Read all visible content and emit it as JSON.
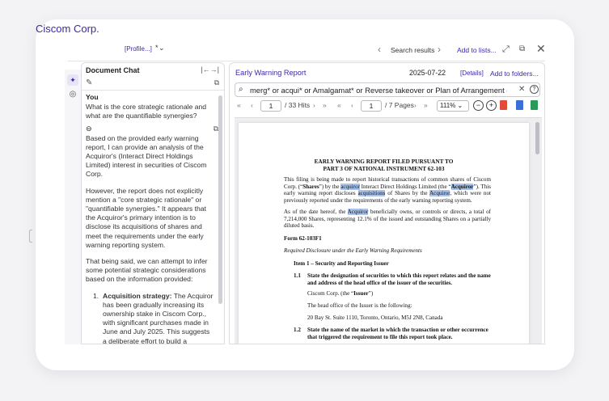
{
  "header": {
    "company": "Ciscom Corp.",
    "profile_link": "[Profile...]",
    "star_mark": "*",
    "nav_label": "Search results",
    "add_to_lists": "Add to lists..."
  },
  "chat": {
    "title": "Document Chat",
    "you_label": "You",
    "question": "What is the core strategic rationale and what are the quantifiable synergies?",
    "paragraphs": [
      "Based on the provided early warning report, I can provide an analysis of the Acquiror's (Interact Direct Holdings Limited) interest in securities of Ciscom Corp.",
      "However, the report does not explicitly mention a \"core strategic rationale\" or \"quantifiable synergies.\" It appears that the Acquiror's primary intention is to disclose its acquisitions of shares and meet the requirements under the early warning reporting system.",
      "That being said, we can attempt to infer some potential strategic considerations based on the information provided:"
    ],
    "list": [
      {
        "num": "1.",
        "title": "Acquisition strategy:",
        "text": " The Acquiror has been gradually increasing its ownership stake in Ciscom Corp., with significant purchases made in June and July 2025. This suggests a deliberate effort to build a substantial shareholding position, which may be indicative of a long-term investment or"
      }
    ]
  },
  "doc": {
    "title": "Early Warning Report",
    "date": "2025-07-22",
    "details": "[Details]",
    "add_to_folders": "Add to folders...",
    "search_query": "merg* or acqui* or Amalgamat* or Reverse takeover or Plan of Arrangement or",
    "hit_current": "1",
    "hit_total": "/ 33 Hits",
    "page_current": "1",
    "page_total": "/ 7 Pages",
    "zoom": "111%",
    "page": {
      "heading1": "EARLY WARNING REPORT FILED PURSUANT TO",
      "heading2": "PART 3 OF NATIONAL INSTRUMENT 62-103",
      "form_title": "Form 62-103F1",
      "required": "Required Disclosure under the Early Warning Requirements",
      "item1": "Item 1 – Security and Reporting Issuer",
      "n11": "1.1",
      "s11": "State the designation of securities to which this report relates and the name and address of the head office of the issuer of the securities.",
      "issuer_line_a": "Ciscom Corp. (the “",
      "issuer_line_b": "Issuer",
      "issuer_line_c": "”)",
      "head_office": "The head office of the Issuer is the following:",
      "address": "20 Bay St. Suite 1110, Toronto, Ontario, M5J 2N8, Canada",
      "n12": "1.2",
      "s12": "State the name of the market in which the transaction or other occurrence that triggered the requirement to file this report took place."
    }
  },
  "colors": {
    "accent": "#3a2aa8",
    "highlight": "#a9c3ec"
  },
  "icons": [
    "chevron-down-icon",
    "chevron-left-icon",
    "chevron-right-icon",
    "expand-icon",
    "external-link-icon",
    "close-icon",
    "sparkle-icon",
    "target-icon",
    "collapse-panel-icon",
    "edit-icon",
    "copy-icon",
    "search-icon",
    "clear-icon",
    "help-icon",
    "pdf-icon",
    "doc-icon"
  ]
}
